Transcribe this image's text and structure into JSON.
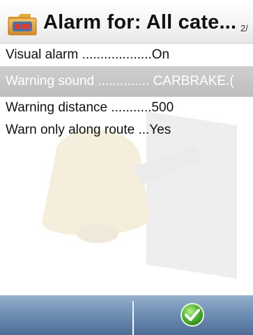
{
  "header": {
    "title": "Alarm for: All cate...",
    "page_indicator": "2/",
    "icon": "folder-alarm-icon"
  },
  "settings": [
    {
      "label": "Visual alarm ...................On",
      "selected": false
    },
    {
      "label": "Warning sound .............. CARBRAKE.(",
      "selected": true
    },
    {
      "label": "Warning distance ...........500",
      "selected": false
    },
    {
      "label": "Warn only along route ...Yes",
      "selected": false
    }
  ],
  "softkeys": {
    "right_icon": "checkmark-ok-icon"
  },
  "colors": {
    "softkey_bar": "#6f8fb4",
    "selection": "#c4c4c4",
    "ok_green": "#3fae2a"
  }
}
